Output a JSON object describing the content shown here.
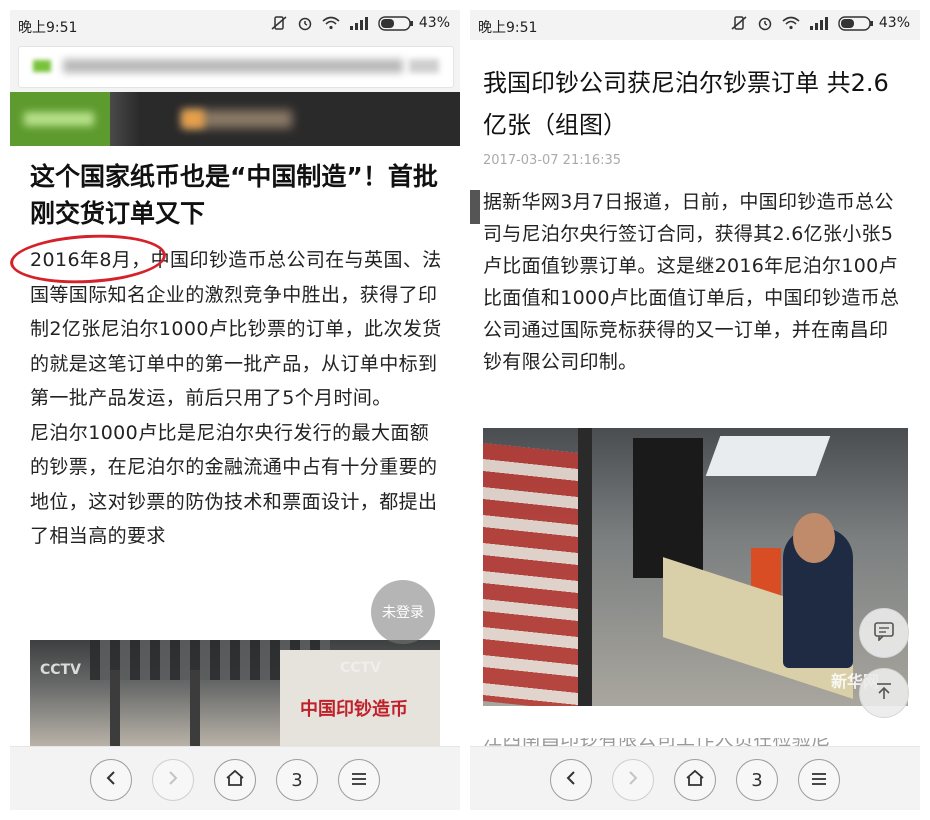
{
  "left": {
    "status": {
      "time": "晚上9:51",
      "battery_pct": "43%"
    },
    "article": {
      "title": "这个国家纸币也是“中国制造”！首批刚交货订单又下",
      "highlight_date": "2016年8月，",
      "p1_rest": "中国印钞造币总公司在与英国、法国等国际知名企业的激烈竞争中胜出，获得了印制2亿张尼泊尔1000卢比钞票的订单，此次发货的就是这笔订单中的第一批产品，从订单中标到第一批产品发运，前后只用了5个月时间。",
      "p2": "尼泊尔1000卢比是尼泊尔央行发行的最大面额的钞票，在尼泊尔的金融流通中占有十分重要的地位，这对钞票的防伪技术和票面设计，都提出了相当高的要求"
    },
    "floating_login": "未登录",
    "photo": {
      "watermark1": "CCTV",
      "watermark2": "CCTV",
      "sign_text": "中国印钞造币"
    },
    "nav": {
      "tabs_count": "3"
    }
  },
  "right": {
    "status": {
      "time": "晚上9:51",
      "battery_pct": "43%"
    },
    "article": {
      "title": "我国印钞公司获尼泊尔钞票订单 共2.6亿张（组图）",
      "date": "2017-03-07 21:16:35",
      "body": "据新华网3月7日报道，日前，中国印钞造币总公司与尼泊尔央行签订合同，获得其2.6亿张小张5卢比面值钞票订单。这是继2016年尼泊尔100卢比面值和1000卢比面值订单后，中国印钞造币总公司通过国际竞标获得的又一订单，并在南昌印钞有限公司印制。",
      "cut_text": "江西南昌印钞有限公司工作人员在检验尼"
    },
    "photo": {
      "watermark": "新华网"
    },
    "nav": {
      "tabs_count": "3"
    }
  },
  "colors": {
    "annotation_red": "#d4212a",
    "banner_green": "#5e9b2f"
  },
  "icons": [
    "wifi-icon",
    "signal-icon",
    "battery-icon",
    "alarm-icon",
    "vibrate-off-icon",
    "back-icon",
    "forward-icon",
    "home-icon",
    "menu-icon",
    "comment-icon",
    "scroll-top-icon"
  ]
}
